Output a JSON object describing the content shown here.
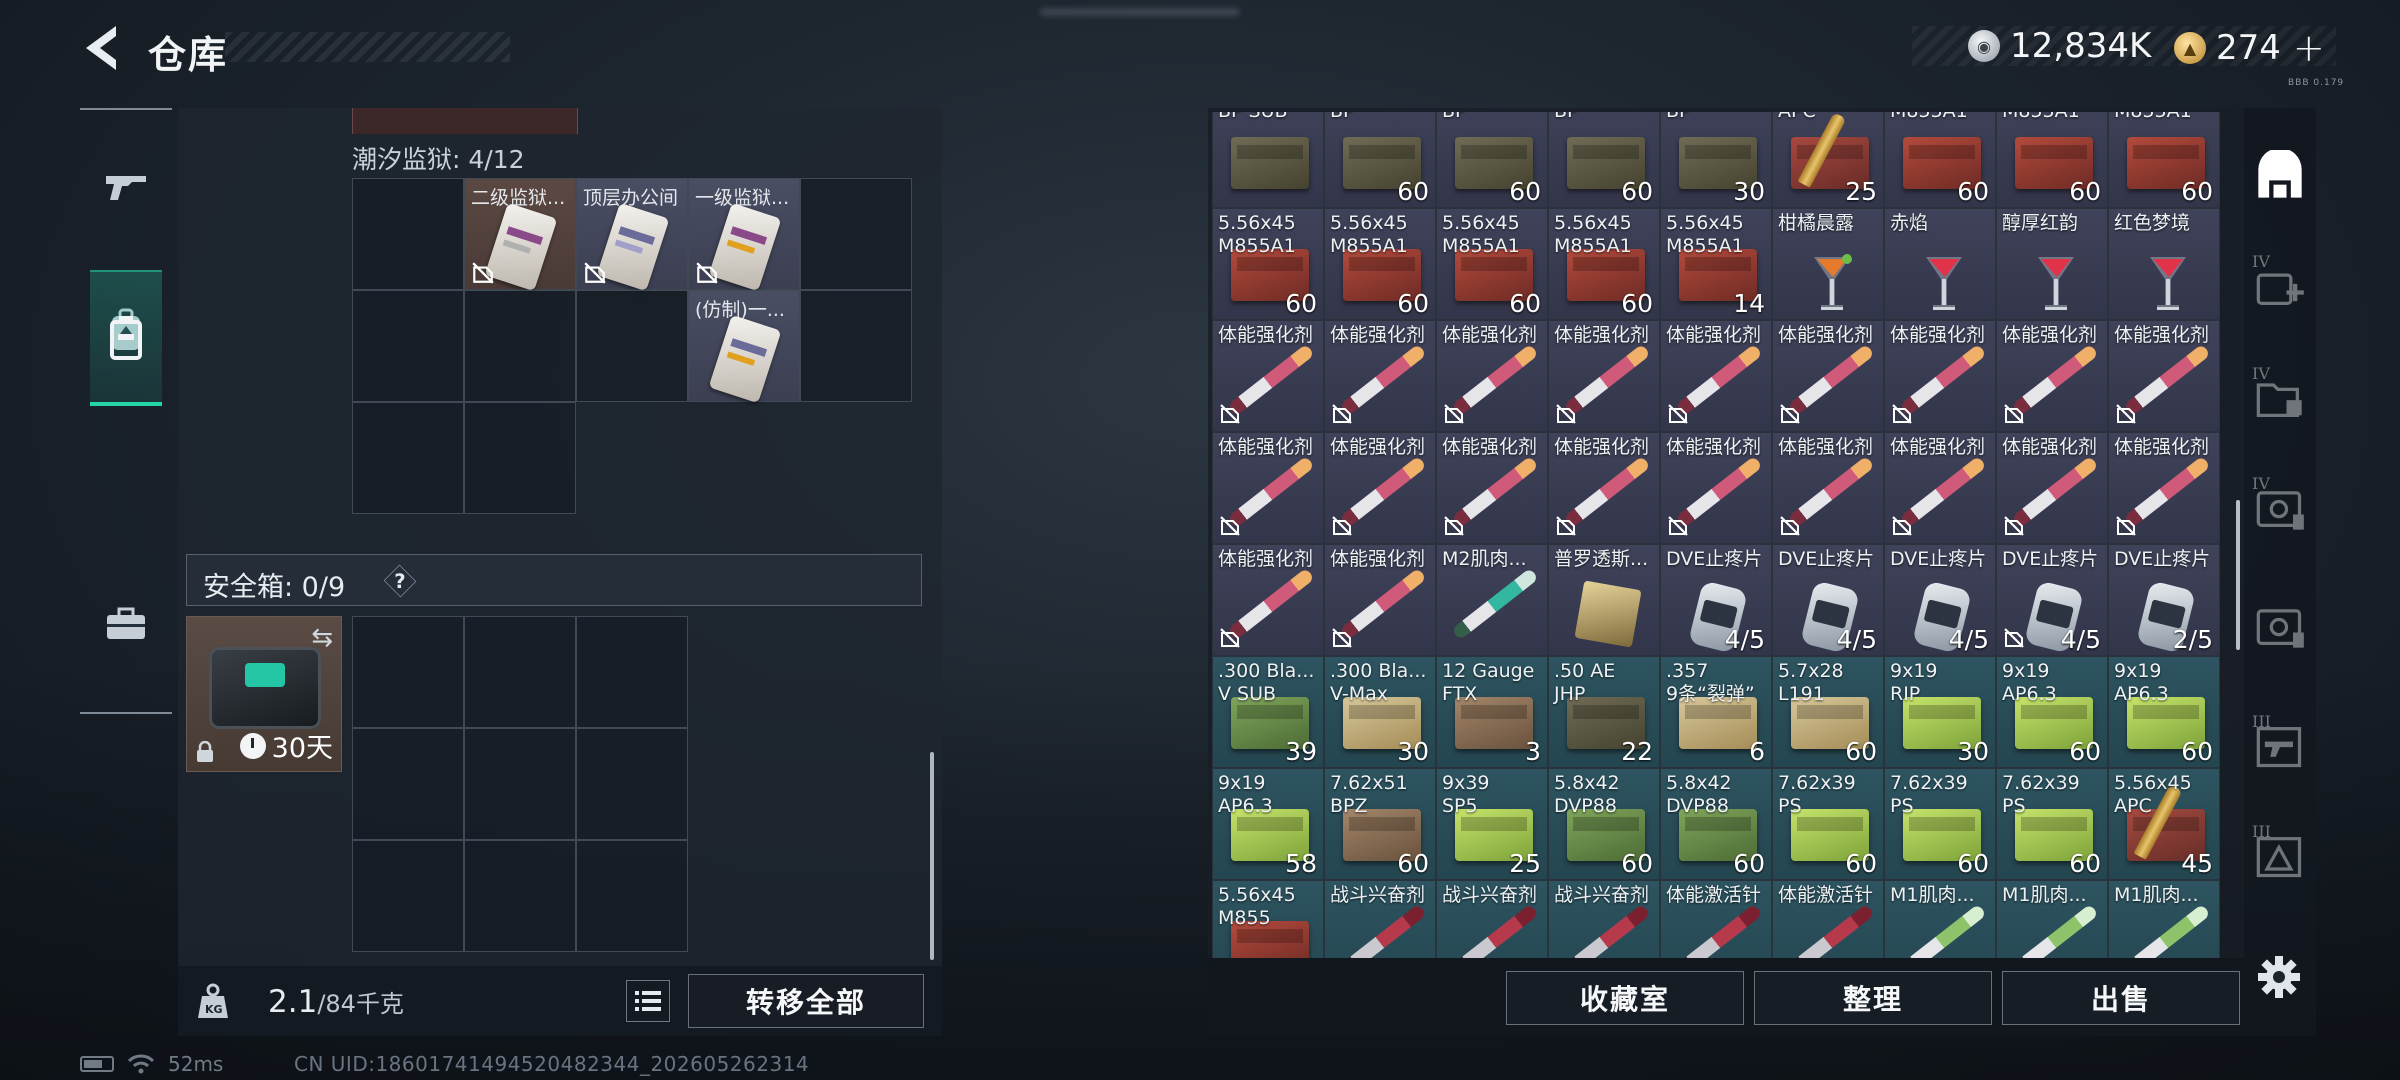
{
  "header": {
    "title": "仓库",
    "currency": {
      "silver": "12,834K",
      "gold": "274"
    },
    "plus": "+",
    "version": "BBB 0.179"
  },
  "left_nav": [
    "weapon-icon",
    "backpack-icon",
    "container-icon",
    "briefcase-icon"
  ],
  "prison": {
    "label": "潮汐监狱: 4/12",
    "items": [
      {
        "name": "二级监狱...",
        "color": "#8a4a8a",
        "accent": "#b0b0b0"
      },
      {
        "name": "顶层办公间",
        "color": "#6b6b9a",
        "accent": "#a0a0c8"
      },
      {
        "name": "一级监狱...",
        "color": "#8a4a8a",
        "accent": "#e0a020"
      },
      {
        "name": "(仿制)一...",
        "color": "#6b6b9a",
        "accent": "#e0a020"
      }
    ]
  },
  "safe": {
    "label": "安全箱: 0/9",
    "help": "?",
    "days": "30天"
  },
  "footer": {
    "weight": "2.1",
    "weight_max": "/84千克",
    "transfer_all": "转移全部",
    "collection": "收藏室",
    "sort": "整理",
    "sell": "出售"
  },
  "status": {
    "ping": "52ms",
    "uid": "CN UID:1860174149452048234​4_202605262314"
  },
  "inventory": [
    {
      "n": "BP SUB",
      "q": "",
      "t": "dark",
      "i": "khaki"
    },
    {
      "n": "BP",
      "q": "60",
      "t": "dark",
      "i": "khaki"
    },
    {
      "n": "BP",
      "q": "60",
      "t": "dark",
      "i": "khaki"
    },
    {
      "n": "BP",
      "q": "60",
      "t": "dark",
      "i": "khaki"
    },
    {
      "n": "BP",
      "q": "30",
      "t": "dark",
      "i": "khaki"
    },
    {
      "n": "APC",
      "q": "25",
      "t": "dark",
      "i": "shell"
    },
    {
      "n": "M855A1",
      "q": "60",
      "t": "dark",
      "i": "red"
    },
    {
      "n": "M855A1",
      "q": "60",
      "t": "dark",
      "i": "red"
    },
    {
      "n": "M855A1",
      "q": "60",
      "t": "dark",
      "i": "red"
    },
    {
      "n": "5.56x45\nM855A1",
      "q": "60",
      "t": "dark",
      "i": "red"
    },
    {
      "n": "5.56x45\nM855A1",
      "q": "60",
      "t": "dark",
      "i": "red"
    },
    {
      "n": "5.56x45\nM855A1",
      "q": "60",
      "t": "dark",
      "i": "red"
    },
    {
      "n": "5.56x45\nM855A1",
      "q": "60",
      "t": "dark",
      "i": "red"
    },
    {
      "n": "5.56x45\nM855A1",
      "q": "14",
      "t": "dark",
      "i": "red"
    },
    {
      "n": "柑橘晨露",
      "q": "",
      "t": "dark",
      "i": "glass-orange"
    },
    {
      "n": "赤焰",
      "q": "",
      "t": "dark",
      "i": "glass-red"
    },
    {
      "n": "醇厚红韵",
      "q": "",
      "t": "dark",
      "i": "glass-red"
    },
    {
      "n": "红色梦境",
      "q": "",
      "t": "dark",
      "i": "glass-red"
    },
    {
      "n": "体能强化剂",
      "q": "",
      "t": "dark",
      "i": "syringe",
      "l": 1
    },
    {
      "n": "体能强化剂",
      "q": "",
      "t": "dark",
      "i": "syringe",
      "l": 1
    },
    {
      "n": "体能强化剂",
      "q": "",
      "t": "dark",
      "i": "syringe",
      "l": 1
    },
    {
      "n": "体能强化剂",
      "q": "",
      "t": "dark",
      "i": "syringe",
      "l": 1
    },
    {
      "n": "体能强化剂",
      "q": "",
      "t": "dark",
      "i": "syringe",
      "l": 1
    },
    {
      "n": "体能强化剂",
      "q": "",
      "t": "dark",
      "i": "syringe",
      "l": 1
    },
    {
      "n": "体能强化剂",
      "q": "",
      "t": "dark",
      "i": "syringe",
      "l": 1
    },
    {
      "n": "体能强化剂",
      "q": "",
      "t": "dark",
      "i": "syringe",
      "l": 1
    },
    {
      "n": "体能强化剂",
      "q": "",
      "t": "dark",
      "i": "syringe",
      "l": 1
    },
    {
      "n": "体能强化剂",
      "q": "",
      "t": "dark",
      "i": "syringe",
      "l": 1
    },
    {
      "n": "体能强化剂",
      "q": "",
      "t": "dark",
      "i": "syringe",
      "l": 1
    },
    {
      "n": "体能强化剂",
      "q": "",
      "t": "dark",
      "i": "syringe",
      "l": 1
    },
    {
      "n": "体能强化剂",
      "q": "",
      "t": "dark",
      "i": "syringe",
      "l": 1
    },
    {
      "n": "体能强化剂",
      "q": "",
      "t": "dark",
      "i": "syringe",
      "l": 1
    },
    {
      "n": "体能强化剂",
      "q": "",
      "t": "dark",
      "i": "syringe",
      "l": 1
    },
    {
      "n": "体能强化剂",
      "q": "",
      "t": "dark",
      "i": "syringe",
      "l": 1
    },
    {
      "n": "体能强化剂",
      "q": "",
      "t": "dark",
      "i": "syringe",
      "l": 1
    },
    {
      "n": "体能强化剂",
      "q": "",
      "t": "dark",
      "i": "syringe",
      "l": 1
    },
    {
      "n": "体能强化剂",
      "q": "",
      "t": "dark",
      "i": "syringe",
      "l": 1
    },
    {
      "n": "体能强化剂",
      "q": "",
      "t": "dark",
      "i": "syringe",
      "l": 1
    },
    {
      "n": "M2肌肉...",
      "q": "",
      "t": "dark",
      "i": "syringe-green"
    },
    {
      "n": "普罗透斯...",
      "q": "",
      "t": "dark",
      "i": "chip"
    },
    {
      "n": "DVE止疼片",
      "q": "4/5",
      "t": "dark",
      "i": "pills"
    },
    {
      "n": "DVE止疼片",
      "q": "4/5",
      "t": "dark",
      "i": "pills"
    },
    {
      "n": "DVE止疼片",
      "q": "4/5",
      "t": "dark",
      "i": "pills"
    },
    {
      "n": "DVE止疼片",
      "q": "4/5",
      "t": "dark",
      "i": "pills",
      "l": 1
    },
    {
      "n": "DVE止疼片",
      "q": "2/5",
      "t": "dark",
      "i": "pills"
    },
    {
      "n": ".300 Bla...\nV SUB",
      "q": "39",
      "t": "teal",
      "i": "olive"
    },
    {
      "n": ".300 Bla...\nV-Max",
      "q": "30",
      "t": "teal",
      "i": "tan"
    },
    {
      "n": "12 Gauge\nFTX",
      "q": "3",
      "t": "teal",
      "i": "brown"
    },
    {
      "n": ".50 AE\nJHP",
      "q": "22",
      "t": "teal",
      "i": "khaki"
    },
    {
      "n": ".357\n9条“裂弹”",
      "q": "6",
      "t": "teal",
      "i": "tan"
    },
    {
      "n": "5.7x28\nL191",
      "q": "60",
      "t": "teal",
      "i": "tan"
    },
    {
      "n": "9x19\nRIP",
      "q": "30",
      "t": "teal",
      "i": "green"
    },
    {
      "n": "9x19\nAP6.3",
      "q": "60",
      "t": "teal",
      "i": "green"
    },
    {
      "n": "9x19\nAP6.3",
      "q": "60",
      "t": "teal",
      "i": "green"
    },
    {
      "n": "9x19\nAP6.3",
      "q": "58",
      "t": "teal",
      "i": "green"
    },
    {
      "n": "7.62x51\nBPZ",
      "q": "60",
      "t": "teal",
      "i": "brown"
    },
    {
      "n": "9x39\nSP5",
      "q": "25",
      "t": "teal",
      "i": "green"
    },
    {
      "n": "5.8x42\nDVP88",
      "q": "60",
      "t": "teal",
      "i": "olive"
    },
    {
      "n": "5.8x42\nDVP88",
      "q": "60",
      "t": "teal",
      "i": "olive"
    },
    {
      "n": "7.62x39\nPS",
      "q": "60",
      "t": "teal",
      "i": "green"
    },
    {
      "n": "7.62x39\nPS",
      "q": "60",
      "t": "teal",
      "i": "green"
    },
    {
      "n": "7.62x39\nPS",
      "q": "60",
      "t": "teal",
      "i": "green"
    },
    {
      "n": "5.56x45\nAPC",
      "q": "45",
      "t": "teal",
      "i": "shell"
    },
    {
      "n": "5.56x45\nM855",
      "q": "",
      "t": "teal",
      "i": "red"
    },
    {
      "n": "战斗兴奋剂",
      "q": "",
      "t": "teal",
      "i": "syringe-dred"
    },
    {
      "n": "战斗兴奋剂",
      "q": "",
      "t": "teal",
      "i": "syringe-dred"
    },
    {
      "n": "战斗兴奋剂",
      "q": "",
      "t": "teal",
      "i": "syringe-dred"
    },
    {
      "n": "体能激活针",
      "q": "",
      "t": "teal",
      "i": "syringe-dred"
    },
    {
      "n": "体能激活针",
      "q": "",
      "t": "teal",
      "i": "syringe-dred"
    },
    {
      "n": "M1肌肉...",
      "q": "",
      "t": "teal",
      "i": "syringe-lime"
    },
    {
      "n": "M1肌肉...",
      "q": "",
      "t": "teal",
      "i": "syringe-lime"
    },
    {
      "n": "M1肌肉...",
      "q": "",
      "t": "teal",
      "i": "syringe-lime"
    }
  ],
  "right_nav": [
    {
      "icon": "warehouse-icon",
      "tier": ""
    },
    {
      "icon": "medkit-icon",
      "tier": "IV"
    },
    {
      "icon": "folder-icon",
      "tier": "IV"
    },
    {
      "icon": "safe-icon",
      "tier": "IV"
    },
    {
      "icon": "safe-icon",
      "tier": ""
    },
    {
      "icon": "gun-rack-icon",
      "tier": "III"
    },
    {
      "icon": "triangle-box-icon",
      "tier": "III"
    }
  ]
}
